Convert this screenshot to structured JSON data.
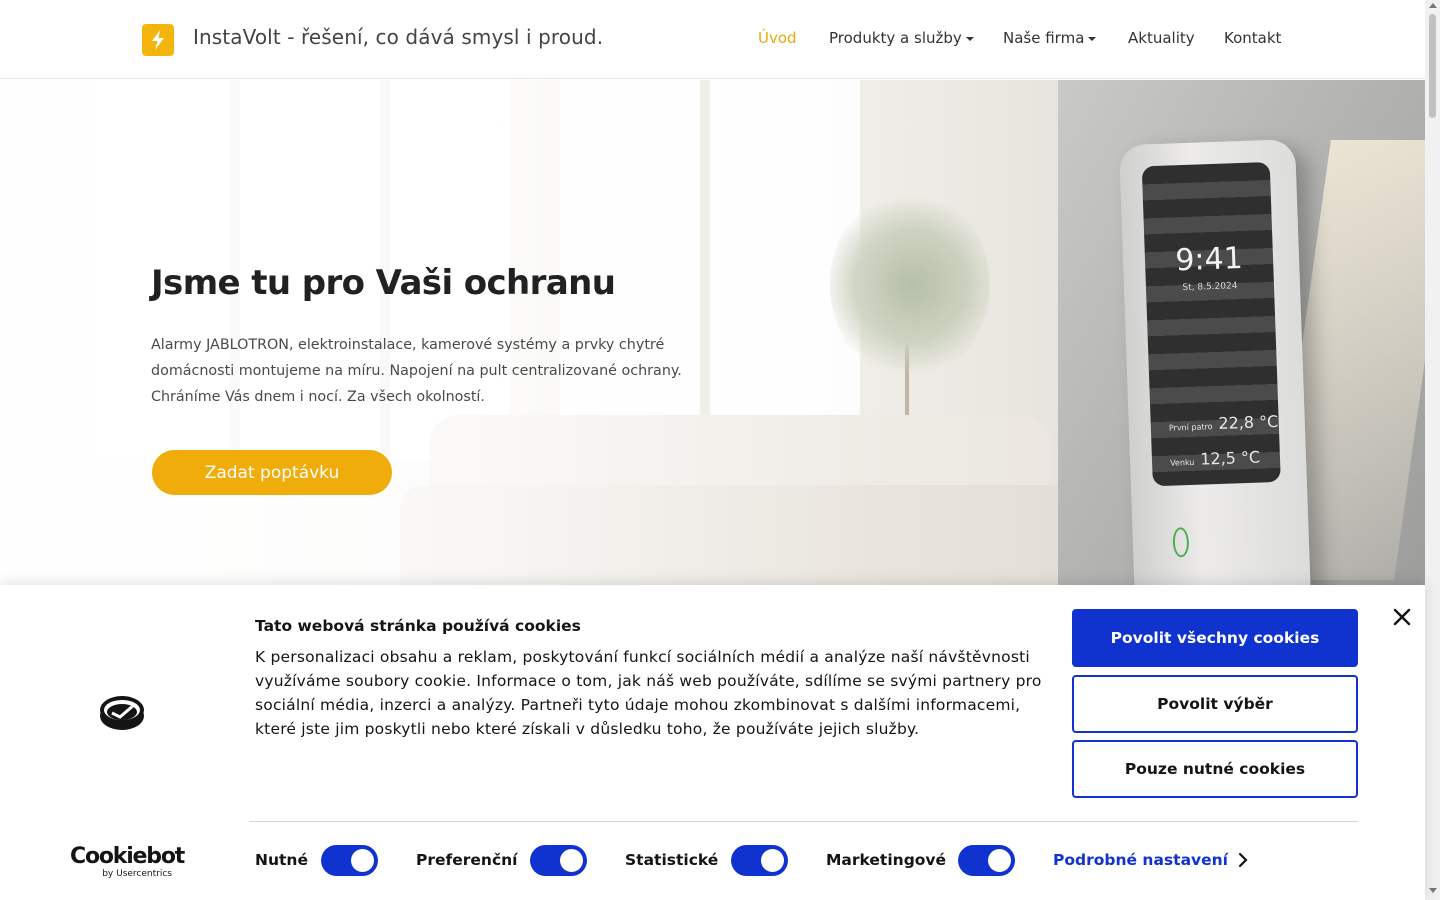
{
  "header": {
    "brand_title": "InstaVolt - řešení, co dává smysl i proud.",
    "nav": [
      {
        "label": "Úvod",
        "active": true,
        "dropdown": false
      },
      {
        "label": "Produkty a služby",
        "active": false,
        "dropdown": true
      },
      {
        "label": "Naše firma",
        "active": false,
        "dropdown": true
      },
      {
        "label": "Aktuality",
        "active": false,
        "dropdown": false
      },
      {
        "label": "Kontakt",
        "active": false,
        "dropdown": false
      }
    ]
  },
  "hero": {
    "title": "Jsme tu pro Vaši ochranu",
    "text": "Alarmy JABLOTRON, elektroinstalace, kamerové systémy a prvky chytré domácnosti montujeme na míru. Napojení na pult centralizované ochrany. Chráníme Vás dnem i nocí. Za všech okolností.",
    "cta_label": "Zadat poptávku",
    "device": {
      "time": "9:41",
      "date": "St, 8.5.2024",
      "row1_label": "První patro",
      "row1_value": "22,8 °C",
      "row2_label": "Venku",
      "row2_value": "12,5 °C"
    }
  },
  "cookie_banner": {
    "heading": "Tato webová stránka používá cookies",
    "text": "K personalizaci obsahu a reklam, poskytování funkcí sociálních médií a analýze naší návštěvnosti využíváme soubory cookie. Informace o tom, jak náš web používáte, sdílíme se svými partnery pro sociální média, inzerci a analýzy. Partneři tyto údaje mohou zkombinovat s dalšími informacemi, které jste jim poskytli nebo které získali v důsledku toho, že používáte jejich služby.",
    "buttons": {
      "allow_all": "Povolit všechny cookies",
      "allow_selection": "Povolit výběr",
      "necessary_only": "Pouze nutné cookies"
    },
    "toggles": [
      {
        "label": "Nutné",
        "checked": true
      },
      {
        "label": "Preferenční",
        "checked": true
      },
      {
        "label": "Statistické",
        "checked": true
      },
      {
        "label": "Marketingové",
        "checked": true
      }
    ],
    "details_link": "Podrobné nastavení",
    "logo_word": "Cookiebot",
    "logo_sub": "by Usercentrics"
  },
  "colors": {
    "accent": "#f0ac0a",
    "cookie_blue": "#1032cf",
    "text_dark": "#212121"
  },
  "icons": [
    "lightning-icon",
    "caret-down-icon",
    "close-icon",
    "cookie-icon",
    "chevron-right-icon"
  ]
}
